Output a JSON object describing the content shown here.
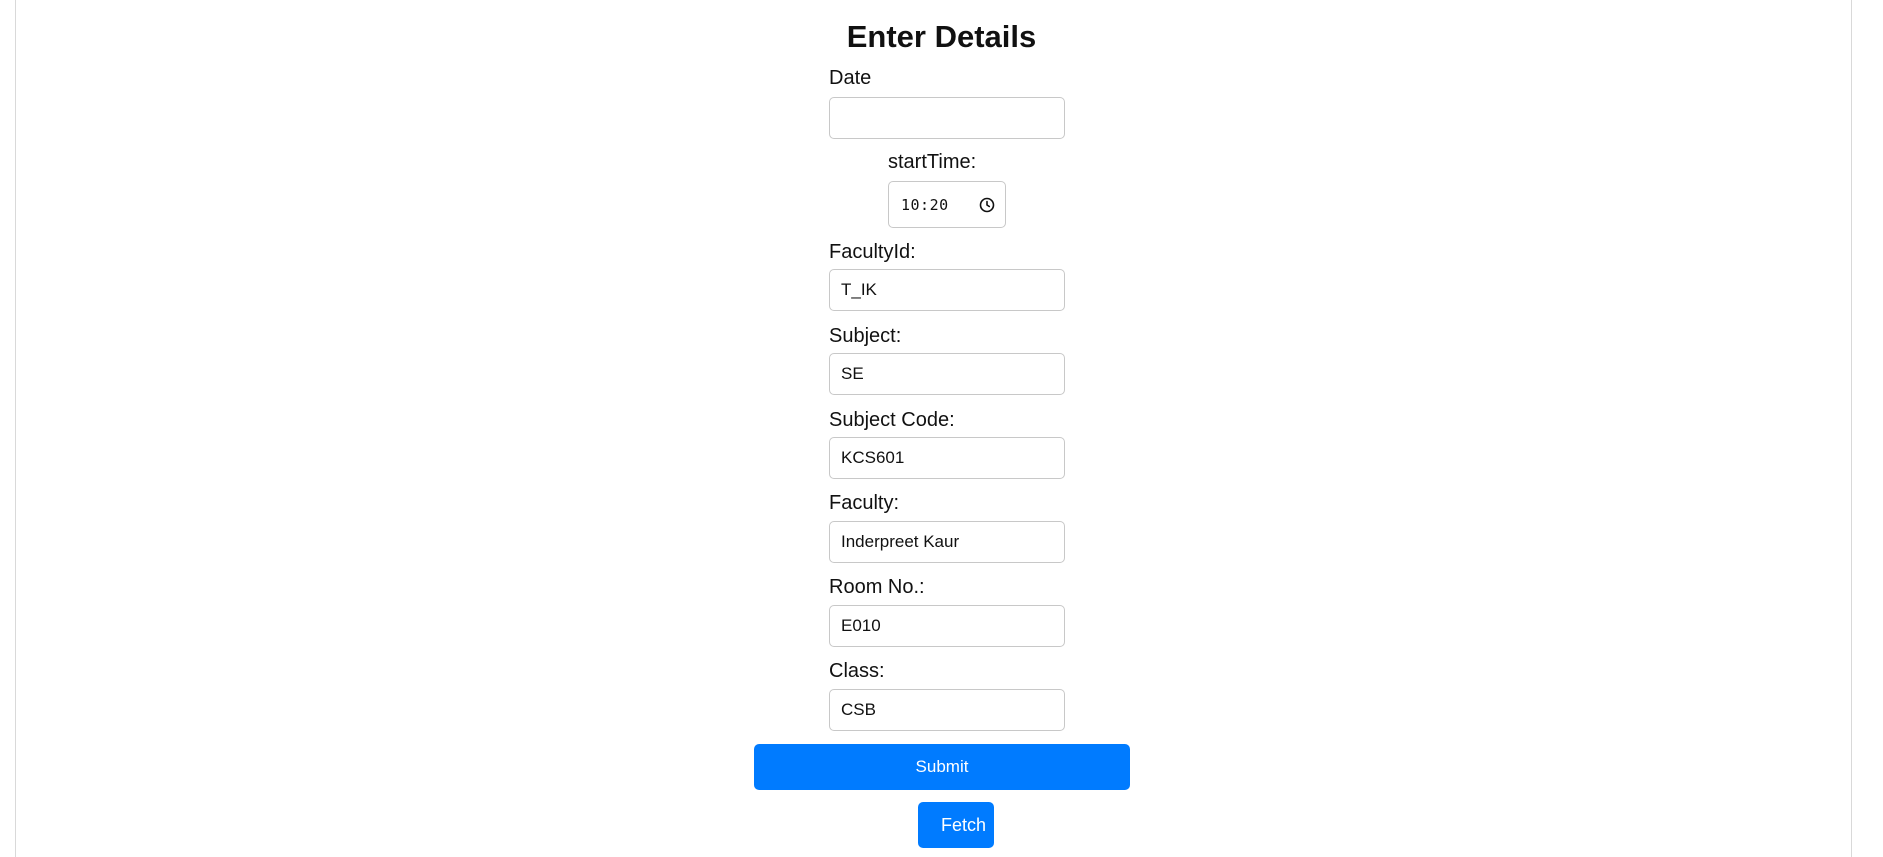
{
  "form": {
    "title": "Enter Details",
    "date": {
      "label": "Date",
      "value": ""
    },
    "start_time": {
      "label": "startTime:",
      "value": "10:20"
    },
    "faculty_id": {
      "label": "FacultyId:",
      "value": "T_IK"
    },
    "subject": {
      "label": "Subject:",
      "value": "SE"
    },
    "subject_code": {
      "label": "Subject Code:",
      "value": "KCS601"
    },
    "faculty": {
      "label": "Faculty:",
      "value": "Inderpreet Kaur"
    },
    "room_no": {
      "label": "Room No.:",
      "value": "E010"
    },
    "class_name": {
      "label": "Class:",
      "value": "CSB"
    },
    "submit_label": "Submit",
    "fetch_label": "Fetch"
  },
  "colors": {
    "button": "#007bff",
    "button_text": "#ffffff",
    "field_border": "#c8c8c8"
  },
  "icons": {
    "time": "clock-icon"
  }
}
